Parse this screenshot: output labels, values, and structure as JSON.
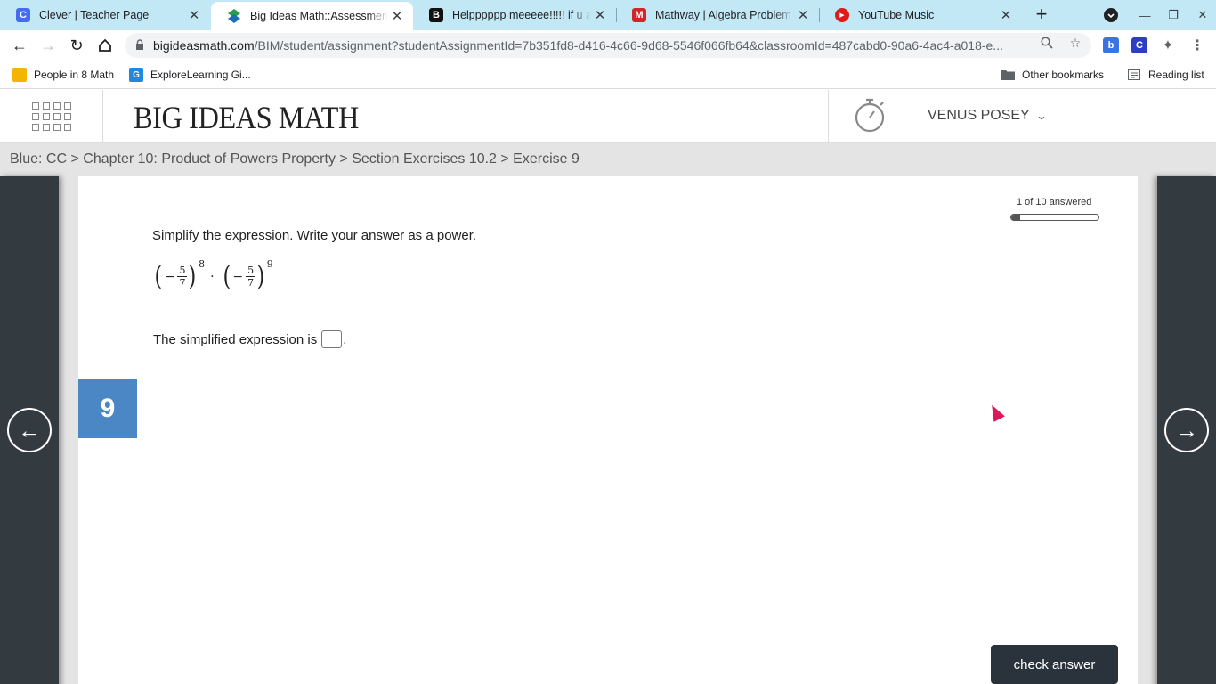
{
  "browser": {
    "tabs": [
      {
        "title": "Clever | Teacher Page",
        "favicon": "clever-icon",
        "favicon_letter": "C",
        "color": "#436cf2",
        "active": false
      },
      {
        "title": "Big Ideas Math::Assessment",
        "favicon": "big-ideas-math-icon",
        "favicon_letter": "",
        "color": "#2a9d4a",
        "active": true
      },
      {
        "title": "Helpppppp meeeee!!!!! if u ans",
        "favicon": "brainly-icon",
        "favicon_letter": "B",
        "color": "#111111",
        "active": false
      },
      {
        "title": "Mathway | Algebra Problem Sol",
        "favicon": "mathway-icon",
        "favicon_letter": "M",
        "color": "#d02626",
        "active": false
      },
      {
        "title": "YouTube Music",
        "favicon": "youtube-music-icon",
        "favicon_letter": "▶",
        "color": "#e01a1a",
        "active": false
      }
    ],
    "url_host": "bigideasmath.com",
    "url_path": "/BIM/student/assignment?studentAssignmentId=7b351fd8-d416-4c66-9d68-5546f066fb64&classroomId=487cabd0-90a6-4ac4-a018-e...",
    "bookmarks": [
      {
        "label": "People in 8 Math",
        "icon": "google-classroom-icon",
        "color": "#f4b400"
      },
      {
        "label": "ExploreLearning Gi...",
        "icon": "explorelearning-icon",
        "color": "#1e88e5"
      }
    ],
    "other_bookmarks": "Other bookmarks",
    "reading_list": "Reading list"
  },
  "header": {
    "logo": "BIG IDEAS MATH",
    "user_name": "VENUS POSEY"
  },
  "breadcrumb": "Blue: CC > Chapter 10: Product of Powers Property > Section Exercises 10.2 > Exercise 9",
  "exercise": {
    "number": "9",
    "progress_text": "1 of 10 answered",
    "progress_fraction": 0.1,
    "prompt": "Simplify the expression. Write your answer as a power.",
    "expression": {
      "minus": "−",
      "numerator": "5",
      "denominator": "7",
      "exp1": "8",
      "exp2": "9",
      "operator": "·"
    },
    "answer_prefix": "The simplified expression is",
    "answer_suffix": ".",
    "check_button": "check answer"
  }
}
